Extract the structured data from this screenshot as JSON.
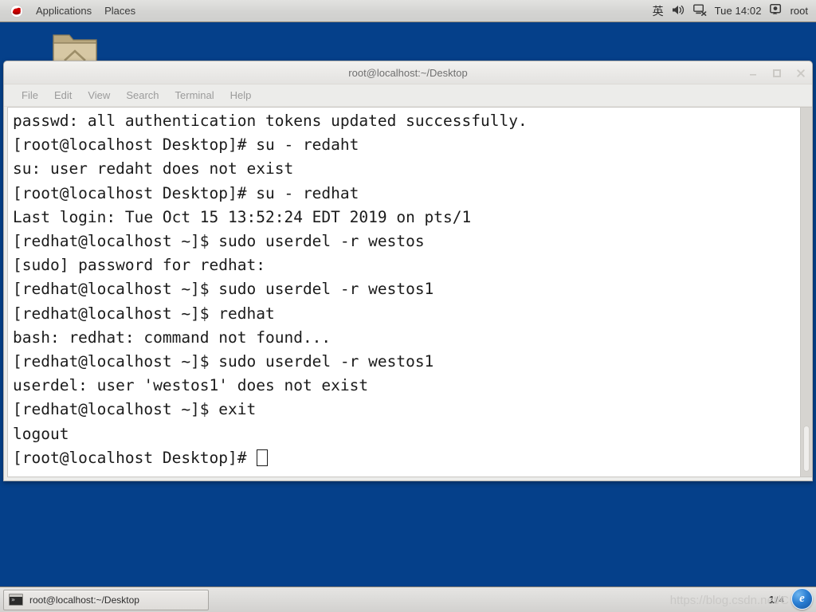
{
  "top_panel": {
    "logo_icon": "redhat-logo-icon",
    "menus": [
      {
        "label": "Applications"
      },
      {
        "label": "Places"
      }
    ],
    "status": {
      "input_method": "英",
      "volume_icon": "volume-speaker-icon",
      "network_icon": "network-disconnected-icon",
      "clock": "Tue 14:02",
      "user_icon": "user-account-icon",
      "user": "root"
    }
  },
  "desktop": {
    "background_color": "#05408a",
    "icons": [
      {
        "name": "home-folder-icon",
        "label": ""
      }
    ]
  },
  "terminal_window": {
    "title": "root@localhost:~/Desktop",
    "controls": {
      "minimize": "minimize-icon",
      "maximize": "maximize-icon",
      "close": "close-icon"
    },
    "menu_bar": [
      {
        "label": "File"
      },
      {
        "label": "Edit"
      },
      {
        "label": "View"
      },
      {
        "label": "Search"
      },
      {
        "label": "Terminal"
      },
      {
        "label": "Help"
      }
    ],
    "lines": [
      "passwd: all authentication tokens updated successfully.",
      "[root@localhost Desktop]# su - redaht",
      "su: user redaht does not exist",
      "[root@localhost Desktop]# su - redhat",
      "Last login: Tue Oct 15 13:52:24 EDT 2019 on pts/1",
      "[redhat@localhost ~]$ sudo userdel -r westos",
      "[sudo] password for redhat:",
      "[redhat@localhost ~]$ sudo userdel -r westos1",
      "[redhat@localhost ~]$ redhat",
      "bash: redhat: command not found...",
      "[redhat@localhost ~]$ sudo userdel -r westos1",
      "userdel: user 'westos1' does not exist",
      "[redhat@localhost ~]$ exit",
      "logout"
    ],
    "prompt": "[root@localhost Desktop]# ",
    "cursor": "block-cursor"
  },
  "bottom_panel": {
    "task_button": {
      "icon": "terminal-icon",
      "label": "root@localhost:~/Desktop"
    },
    "workspace": {
      "current": "1",
      "separator": "/",
      "total": "4"
    },
    "watermark": "https://blog.csdn.net/C",
    "badge": "e"
  }
}
